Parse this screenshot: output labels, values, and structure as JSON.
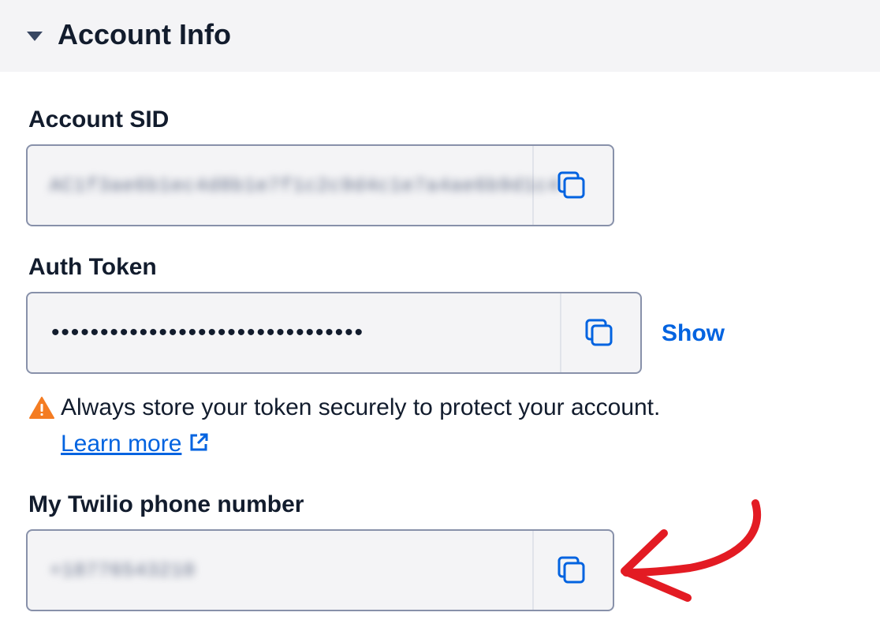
{
  "section": {
    "title": "Account Info"
  },
  "account_sid": {
    "label": "Account SID",
    "value_blurred": "AC1f3ae6b1ec4d8b1e7f1c2c9d4c1e7a4ae6b9d1c4"
  },
  "auth_token": {
    "label": "Auth Token",
    "value_masked": "••••••••••••••••••••••••••••••••",
    "show_label": "Show"
  },
  "warning": {
    "text": "Always store your token securely to protect your account.",
    "link_label": "Learn more"
  },
  "phone_number": {
    "label": "My Twilio phone number",
    "value_blurred": "+18776543210"
  },
  "colors": {
    "link": "#0263e0",
    "warning": "#f47c22",
    "annotation_arrow": "#e31b23",
    "field_bg": "#f4f4f6",
    "field_border": "#8891aa"
  },
  "icons": {
    "caret": "caret-down-icon",
    "copy": "copy-icon",
    "warning": "warning-triangle-icon",
    "external": "external-link-icon"
  }
}
